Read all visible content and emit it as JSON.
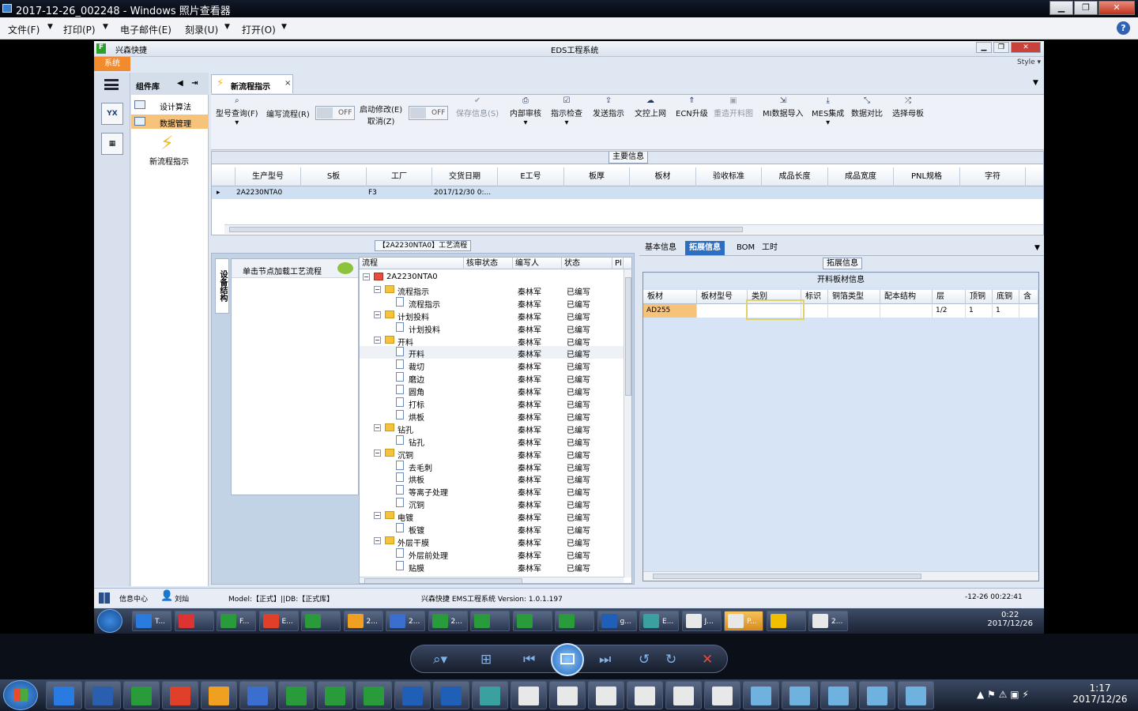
{
  "viewer": {
    "title": "2017-12-26_002248 - Windows 照片查看器",
    "menu": [
      "文件(F)",
      "打印(P)",
      "电子邮件(E)",
      "刻录(U)",
      "打开(O)"
    ],
    "help": "?"
  },
  "eds": {
    "brand": "兴森快捷",
    "title": "EDS工程系统",
    "sys_tab": "系统",
    "style": "Style",
    "sidebar": {
      "library": "组件库",
      "items": [
        "设计算法",
        "数据管理"
      ],
      "new_flow": "新流程指示",
      "icon_yx": "YX"
    },
    "doc_tab": "新流程指示",
    "toolbar": [
      {
        "label": "型号查询(F)",
        "icon": "search-icon"
      },
      {
        "label": "编写流程(R)",
        "icon": "edit-icon"
      },
      {
        "label": "启动修改(E)",
        "label2": "取消(Z)",
        "icon": "toggle-icon"
      },
      {
        "label": "保存信息(S)",
        "icon": "check-icon",
        "disabled": true
      },
      {
        "label": "内部审核",
        "icon": "print-icon"
      },
      {
        "label": "指示检查",
        "icon": "check-box-icon"
      },
      {
        "label": "发送指示",
        "icon": "upload-icon"
      },
      {
        "label": "文控上网",
        "icon": "cloud-icon"
      },
      {
        "label": "ECN升级",
        "icon": "arrow-up-icon"
      },
      {
        "label": "重造开料图",
        "icon": "image-icon",
        "disabled": true
      },
      {
        "label": "MI数据导入",
        "icon": "import-icon"
      },
      {
        "label": "MES集成",
        "icon": "download-icon"
      },
      {
        "label": "数据对比",
        "icon": "compare-icon"
      },
      {
        "label": "选择母板",
        "icon": "shuffle-icon"
      }
    ],
    "toggle_off": "OFF",
    "main_info": {
      "caption": "主要信息",
      "columns": [
        "生产型号",
        "S板",
        "工厂",
        "交货日期",
        "E工号",
        "板厚",
        "板材",
        "验收标准",
        "成品长度",
        "成品宽度",
        "PNL规格",
        "字符"
      ],
      "rows": [
        [
          "2A2230NTA0",
          "",
          "F3",
          "2017/12/30 0:...",
          "",
          "",
          "",
          "",
          "",
          "",
          "",
          ""
        ]
      ]
    },
    "process": {
      "caption": "【2A2230NTA0】工艺流程",
      "vtab": "设备结构",
      "left_header": "单击节点加载工艺流程",
      "columns": [
        "流程",
        "核审状态",
        "编写人",
        "状态",
        "Pl"
      ],
      "rows": [
        {
          "name": "2A2230NTA0",
          "level": 0,
          "type": "root",
          "writer": "",
          "status": ""
        },
        {
          "name": "流程指示",
          "level": 1,
          "type": "folder",
          "writer": "秦林军",
          "status": "已编写"
        },
        {
          "name": "流程指示",
          "level": 2,
          "type": "doc",
          "writer": "秦林军",
          "status": "已编写"
        },
        {
          "name": "计划投料",
          "level": 1,
          "type": "folder",
          "writer": "秦林军",
          "status": "已编写"
        },
        {
          "name": "计划投料",
          "level": 2,
          "type": "doc",
          "writer": "秦林军",
          "status": "已编写"
        },
        {
          "name": "开料",
          "level": 1,
          "type": "folder",
          "writer": "秦林军",
          "status": "已编写"
        },
        {
          "name": "开料",
          "level": 2,
          "type": "doc",
          "writer": "秦林军",
          "status": "已编写"
        },
        {
          "name": "裁切",
          "level": 2,
          "type": "doc",
          "writer": "秦林军",
          "status": "已编写"
        },
        {
          "name": "磨边",
          "level": 2,
          "type": "doc",
          "writer": "秦林军",
          "status": "已编写"
        },
        {
          "name": "圆角",
          "level": 2,
          "type": "doc",
          "writer": "秦林军",
          "status": "已编写"
        },
        {
          "name": "打标",
          "level": 2,
          "type": "doc",
          "writer": "秦林军",
          "status": "已编写"
        },
        {
          "name": "烘板",
          "level": 2,
          "type": "doc",
          "writer": "秦林军",
          "status": "已编写"
        },
        {
          "name": "钻孔",
          "level": 1,
          "type": "folder",
          "writer": "秦林军",
          "status": "已编写"
        },
        {
          "name": "钻孔",
          "level": 2,
          "type": "doc",
          "writer": "秦林军",
          "status": "已编写"
        },
        {
          "name": "沉铜",
          "level": 1,
          "type": "folder",
          "writer": "秦林军",
          "status": "已编写"
        },
        {
          "name": "去毛刺",
          "level": 2,
          "type": "doc",
          "writer": "秦林军",
          "status": "已编写"
        },
        {
          "name": "烘板",
          "level": 2,
          "type": "doc",
          "writer": "秦林军",
          "status": "已编写"
        },
        {
          "name": "等离子处理",
          "level": 2,
          "type": "doc",
          "writer": "秦林军",
          "status": "已编写"
        },
        {
          "name": "沉铜",
          "level": 2,
          "type": "doc",
          "writer": "秦林军",
          "status": "已编写"
        },
        {
          "name": "电镀",
          "level": 1,
          "type": "folder",
          "writer": "秦林军",
          "status": "已编写"
        },
        {
          "name": "板镀",
          "level": 2,
          "type": "doc",
          "writer": "秦林军",
          "status": "已编写"
        },
        {
          "name": "外层干膜",
          "level": 1,
          "type": "folder",
          "writer": "秦林军",
          "status": "已编写"
        },
        {
          "name": "外层前处理",
          "level": 2,
          "type": "doc",
          "writer": "秦林军",
          "status": "已编写"
        },
        {
          "name": "贴膜",
          "level": 2,
          "type": "doc",
          "writer": "秦林军",
          "status": "已编写"
        }
      ]
    },
    "right_tabs": [
      "基本信息",
      "拓展信息",
      "BOM",
      "工时"
    ],
    "ext": {
      "caption": "拓展信息",
      "title": "开料板材信息",
      "columns": [
        "板材",
        "板材型号",
        "类别",
        "标识",
        "铜箔类型",
        "配本结构",
        "层",
        "顶铜",
        "底铜",
        "含铜"
      ],
      "rows": [
        [
          "AD255",
          "",
          "",
          "",
          "",
          "",
          "1/2",
          "1",
          "1",
          ""
        ]
      ]
    },
    "status": {
      "info_center": "信息中心",
      "user": "刘灿",
      "model": "Model:【正式】||DB:【正式库】",
      "app": "兴森快捷 EMS工程系统 Version: 1.0.1.197",
      "time": "-12-26 00:22:41"
    },
    "inner_taskbar": {
      "buttons": [
        "T...",
        "",
        "F...",
        "E...",
        "",
        "2...",
        "2...",
        "2...",
        "",
        "",
        "",
        "g...",
        "E...",
        "J...",
        "P...",
        "",
        "2..."
      ],
      "clock_time": "0:22",
      "clock_date": "2017/12/26"
    }
  },
  "outer_taskbar": {
    "clock_time": "1:17",
    "clock_date": "2017/12/26"
  },
  "colors": {
    "accent": "#2c6fc0",
    "orange": "#f28a2e",
    "selected_row": "#cfe0f3"
  }
}
